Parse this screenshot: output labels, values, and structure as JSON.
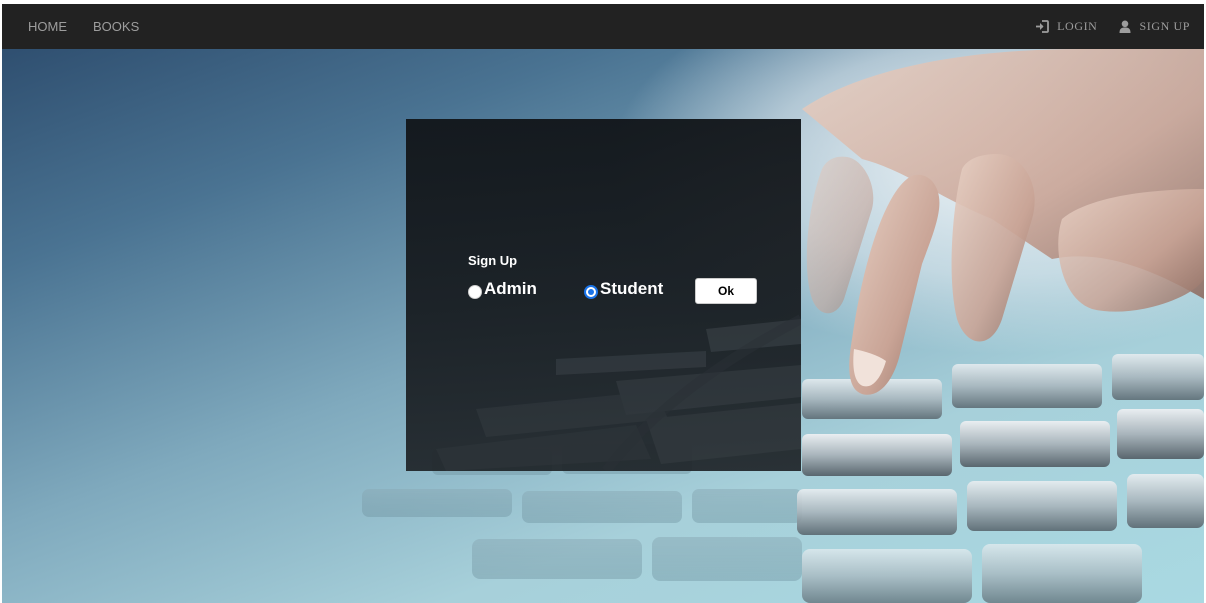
{
  "nav": {
    "home_label": "HOME",
    "books_label": "BOOKS",
    "login_label": "LOGIN",
    "signup_label": "SIGN UP",
    "login_icon": "sign-in-icon",
    "signup_icon": "user-icon"
  },
  "signup_panel": {
    "title": "Sign Up",
    "options": [
      {
        "label": "Admin",
        "selected": false
      },
      {
        "label": "Student",
        "selected": true
      }
    ],
    "ok_label": "Ok"
  },
  "colors": {
    "navbar_bg": "#222222",
    "nav_text": "#9d9d9d",
    "panel_bg": "#16191d",
    "radio_accent": "#1a73e8"
  }
}
